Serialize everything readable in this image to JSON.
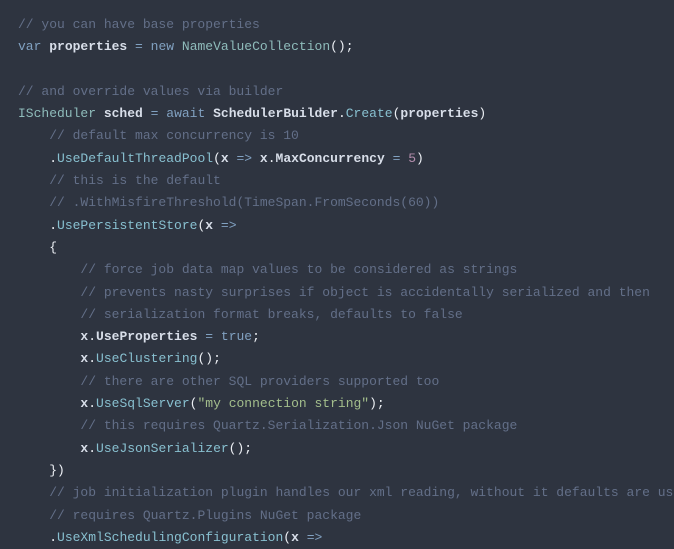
{
  "code": {
    "lines": [
      [
        {
          "cls": "cm",
          "t": "// you can have base properties"
        }
      ],
      [
        {
          "cls": "kw",
          "t": "var"
        },
        {
          "cls": "",
          "t": " "
        },
        {
          "cls": "id",
          "t": "properties"
        },
        {
          "cls": "",
          "t": " "
        },
        {
          "cls": "kw",
          "t": "="
        },
        {
          "cls": "",
          "t": " "
        },
        {
          "cls": "kw",
          "t": "new"
        },
        {
          "cls": "",
          "t": " "
        },
        {
          "cls": "typ",
          "t": "NameValueCollection"
        },
        {
          "cls": "pct",
          "t": "();"
        }
      ],
      [],
      [
        {
          "cls": "cm",
          "t": "// and override values via builder"
        }
      ],
      [
        {
          "cls": "typ",
          "t": "IScheduler"
        },
        {
          "cls": "",
          "t": " "
        },
        {
          "cls": "id",
          "t": "sched"
        },
        {
          "cls": "",
          "t": " "
        },
        {
          "cls": "kw",
          "t": "="
        },
        {
          "cls": "",
          "t": " "
        },
        {
          "cls": "kw",
          "t": "await"
        },
        {
          "cls": "",
          "t": " "
        },
        {
          "cls": "id",
          "t": "SchedulerBuilder"
        },
        {
          "cls": "pct",
          "t": "."
        },
        {
          "cls": "mth",
          "t": "Create"
        },
        {
          "cls": "pct",
          "t": "("
        },
        {
          "cls": "id",
          "t": "properties"
        },
        {
          "cls": "pct",
          "t": ")"
        }
      ],
      [
        {
          "cls": "",
          "t": "    "
        },
        {
          "cls": "cm",
          "t": "// default max concurrency is 10"
        }
      ],
      [
        {
          "cls": "",
          "t": "    "
        },
        {
          "cls": "pct",
          "t": "."
        },
        {
          "cls": "mth",
          "t": "UseDefaultThreadPool"
        },
        {
          "cls": "pct",
          "t": "("
        },
        {
          "cls": "id",
          "t": "x"
        },
        {
          "cls": "",
          "t": " "
        },
        {
          "cls": "kw",
          "t": "=>"
        },
        {
          "cls": "",
          "t": " "
        },
        {
          "cls": "id",
          "t": "x"
        },
        {
          "cls": "pct",
          "t": "."
        },
        {
          "cls": "id",
          "t": "MaxConcurrency"
        },
        {
          "cls": "",
          "t": " "
        },
        {
          "cls": "kw",
          "t": "="
        },
        {
          "cls": "",
          "t": " "
        },
        {
          "cls": "num",
          "t": "5"
        },
        {
          "cls": "pct",
          "t": ")"
        }
      ],
      [
        {
          "cls": "",
          "t": "    "
        },
        {
          "cls": "cm",
          "t": "// this is the default"
        }
      ],
      [
        {
          "cls": "",
          "t": "    "
        },
        {
          "cls": "cm",
          "t": "// .WithMisfireThreshold(TimeSpan.FromSeconds(60))"
        }
      ],
      [
        {
          "cls": "",
          "t": "    "
        },
        {
          "cls": "pct",
          "t": "."
        },
        {
          "cls": "mth",
          "t": "UsePersistentStore"
        },
        {
          "cls": "pct",
          "t": "("
        },
        {
          "cls": "id",
          "t": "x"
        },
        {
          "cls": "",
          "t": " "
        },
        {
          "cls": "kw",
          "t": "=>"
        }
      ],
      [
        {
          "cls": "",
          "t": "    "
        },
        {
          "cls": "pct",
          "t": "{"
        }
      ],
      [
        {
          "cls": "",
          "t": "        "
        },
        {
          "cls": "cm",
          "t": "// force job data map values to be considered as strings"
        }
      ],
      [
        {
          "cls": "",
          "t": "        "
        },
        {
          "cls": "cm",
          "t": "// prevents nasty surprises if object is accidentally serialized and then"
        }
      ],
      [
        {
          "cls": "",
          "t": "        "
        },
        {
          "cls": "cm",
          "t": "// serialization format breaks, defaults to false"
        }
      ],
      [
        {
          "cls": "",
          "t": "        "
        },
        {
          "cls": "id",
          "t": "x"
        },
        {
          "cls": "pct",
          "t": "."
        },
        {
          "cls": "id",
          "t": "UseProperties"
        },
        {
          "cls": "",
          "t": " "
        },
        {
          "cls": "kw",
          "t": "="
        },
        {
          "cls": "",
          "t": " "
        },
        {
          "cls": "boo",
          "t": "true"
        },
        {
          "cls": "pct",
          "t": ";"
        }
      ],
      [
        {
          "cls": "",
          "t": "        "
        },
        {
          "cls": "id",
          "t": "x"
        },
        {
          "cls": "pct",
          "t": "."
        },
        {
          "cls": "mth",
          "t": "UseClustering"
        },
        {
          "cls": "pct",
          "t": "();"
        }
      ],
      [
        {
          "cls": "",
          "t": "        "
        },
        {
          "cls": "cm",
          "t": "// there are other SQL providers supported too"
        }
      ],
      [
        {
          "cls": "",
          "t": "        "
        },
        {
          "cls": "id",
          "t": "x"
        },
        {
          "cls": "pct",
          "t": "."
        },
        {
          "cls": "mth",
          "t": "UseSqlServer"
        },
        {
          "cls": "pct",
          "t": "("
        },
        {
          "cls": "str",
          "t": "\"my connection string\""
        },
        {
          "cls": "pct",
          "t": ");"
        }
      ],
      [
        {
          "cls": "",
          "t": "        "
        },
        {
          "cls": "cm",
          "t": "// this requires Quartz.Serialization.Json NuGet package"
        }
      ],
      [
        {
          "cls": "",
          "t": "        "
        },
        {
          "cls": "id",
          "t": "x"
        },
        {
          "cls": "pct",
          "t": "."
        },
        {
          "cls": "mth",
          "t": "UseJsonSerializer"
        },
        {
          "cls": "pct",
          "t": "();"
        }
      ],
      [
        {
          "cls": "",
          "t": "    "
        },
        {
          "cls": "pct",
          "t": "})"
        }
      ],
      [
        {
          "cls": "",
          "t": "    "
        },
        {
          "cls": "cm",
          "t": "// job initialization plugin handles our xml reading, without it defaults are used"
        }
      ],
      [
        {
          "cls": "",
          "t": "    "
        },
        {
          "cls": "cm",
          "t": "// requires Quartz.Plugins NuGet package"
        }
      ],
      [
        {
          "cls": "",
          "t": "    "
        },
        {
          "cls": "pct",
          "t": "."
        },
        {
          "cls": "mth",
          "t": "UseXmlSchedulingConfiguration"
        },
        {
          "cls": "pct",
          "t": "("
        },
        {
          "cls": "id",
          "t": "x"
        },
        {
          "cls": "",
          "t": " "
        },
        {
          "cls": "kw",
          "t": "=>"
        }
      ]
    ]
  }
}
